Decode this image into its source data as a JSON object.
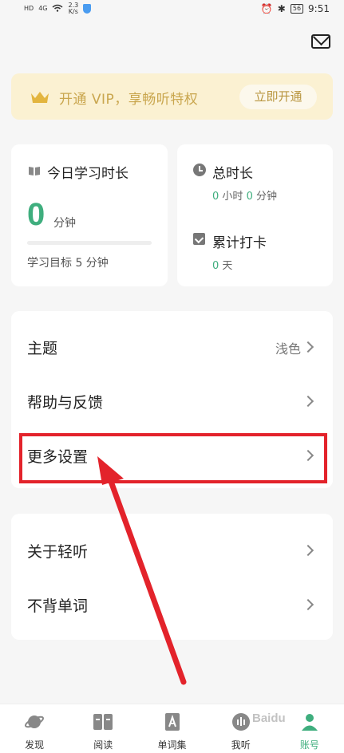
{
  "status_bar": {
    "signal_left": "HD",
    "network": "4G",
    "speed_value": "2.3",
    "speed_unit": "K/s",
    "battery": "56",
    "time": "9:51"
  },
  "vip": {
    "text": "开通 VIP，享畅听特权",
    "button": "立即开通"
  },
  "today": {
    "title": "今日学习时长",
    "value": "0",
    "unit": "分钟",
    "progress": 0,
    "goal": "学习目标 5 分钟"
  },
  "total": {
    "title": "总时长",
    "hours": "0",
    "hours_unit": "小时",
    "minutes": "0",
    "minutes_unit": "分钟"
  },
  "checkin": {
    "title": "累计打卡",
    "days": "0",
    "days_unit": "天"
  },
  "settings_list_1": [
    {
      "label": "主题",
      "value": "浅色"
    },
    {
      "label": "帮助与反馈",
      "value": ""
    },
    {
      "label": "更多设置",
      "value": ""
    }
  ],
  "settings_list_2": [
    {
      "label": "关于轻听",
      "value": ""
    },
    {
      "label": "不背单词",
      "value": ""
    }
  ],
  "bottom_nav": [
    {
      "label": "发现",
      "icon": "planet-icon",
      "active": false
    },
    {
      "label": "阅读",
      "icon": "book-open-icon",
      "active": false
    },
    {
      "label": "单词集",
      "icon": "word-card-icon",
      "active": false
    },
    {
      "label": "我听",
      "icon": "audio-bars-icon",
      "active": false
    },
    {
      "label": "账号",
      "icon": "account-icon",
      "active": true
    }
  ],
  "colors": {
    "accent": "#3fae7e",
    "vip_bg": "#fbf1d2",
    "annotation": "#e3232b"
  },
  "watermark": "Baidu"
}
